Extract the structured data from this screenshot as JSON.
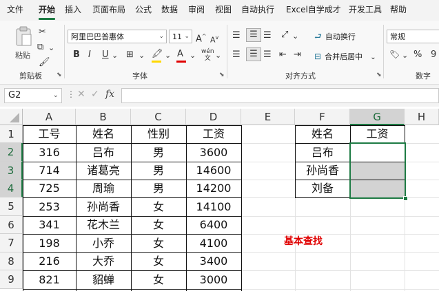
{
  "menu": {
    "items": [
      "文件",
      "开始",
      "插入",
      "页面布局",
      "公式",
      "数据",
      "审阅",
      "视图",
      "自动执行",
      "Excel自学成才",
      "开发工具",
      "帮助"
    ]
  },
  "ribbon": {
    "clipboard": {
      "paste_label": "粘贴",
      "group_label": "剪贴板"
    },
    "font": {
      "font_name": "阿里巴巴普惠体",
      "font_size": "11",
      "grow_label": "A",
      "shrink_label": "A",
      "bold_label": "B",
      "italic_label": "I",
      "underline_label": "U",
      "phonetic_label": "wén",
      "group_label": "字体"
    },
    "alignment": {
      "wrap_label": "自动换行",
      "merge_label": "合并后居中",
      "group_label": "对齐方式"
    },
    "number": {
      "format_value": "常规",
      "percent_label": "%",
      "comma_label": "9",
      "group_label": "数字"
    }
  },
  "formula_bar": {
    "name_box": "G2",
    "fx_label": "fx",
    "content": ""
  },
  "columns": [
    "A",
    "B",
    "C",
    "D",
    "E",
    "F",
    "G",
    "H"
  ],
  "rows": [
    "1",
    "2",
    "3",
    "4",
    "5",
    "6",
    "7",
    "8",
    "9"
  ],
  "table": {
    "headers": [
      "工号",
      "姓名",
      "性别",
      "工资"
    ],
    "rows": [
      [
        "316",
        "吕布",
        "男",
        "3600"
      ],
      [
        "714",
        "诸葛亮",
        "男",
        "14600"
      ],
      [
        "725",
        "周瑜",
        "男",
        "14200"
      ],
      [
        "253",
        "孙尚香",
        "女",
        "14100"
      ],
      [
        "341",
        "花木兰",
        "女",
        "6400"
      ],
      [
        "198",
        "小乔",
        "女",
        "4100"
      ],
      [
        "216",
        "大乔",
        "女",
        "3400"
      ],
      [
        "821",
        "貂蝉",
        "女",
        "3000"
      ]
    ]
  },
  "lookup": {
    "headers": [
      "姓名",
      "工资"
    ],
    "names": [
      "吕布",
      "孙尚香",
      "刘备"
    ],
    "values": [
      "",
      "",
      ""
    ]
  },
  "note": "基本查找",
  "colors": {
    "accent": "#1d7a43",
    "selection_fill": "#d3d3d3",
    "note_red": "#e00000"
  }
}
